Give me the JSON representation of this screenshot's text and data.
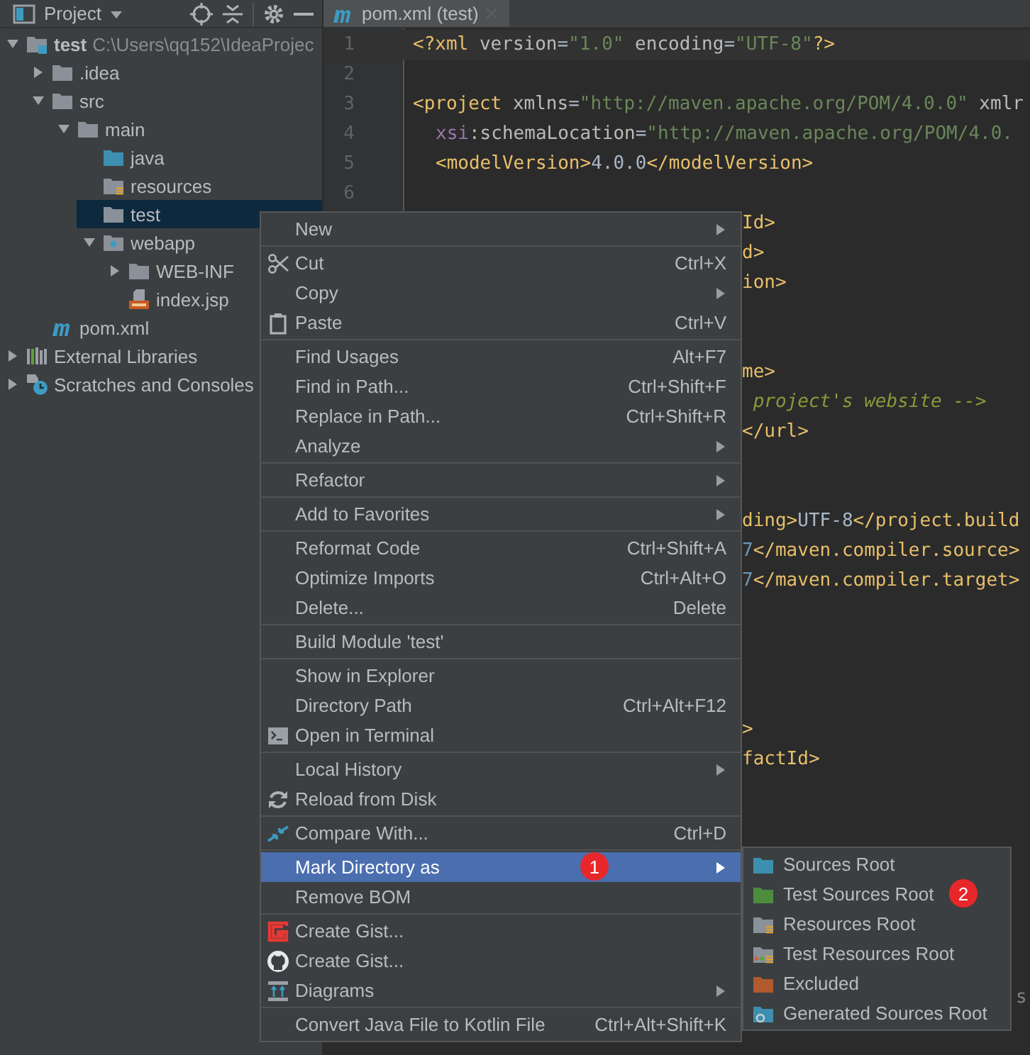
{
  "project_panel": {
    "title": "Project",
    "tree": [
      {
        "label": "test",
        "path": "C:\\Users\\qq152\\IdeaProjec",
        "kind": "module",
        "expanded": true,
        "selected": false,
        "children": [
          {
            "label": ".idea",
            "kind": "folder",
            "expanded": false,
            "selected": false,
            "has_children": true
          },
          {
            "label": "src",
            "kind": "folder",
            "expanded": true,
            "selected": false,
            "children": [
              {
                "label": "main",
                "kind": "folder",
                "expanded": true,
                "selected": false,
                "children": [
                  {
                    "label": "java",
                    "kind": "source",
                    "selected": false
                  },
                  {
                    "label": "resources",
                    "kind": "resources",
                    "selected": false
                  },
                  {
                    "label": "test",
                    "kind": "folder",
                    "selected": true
                  },
                  {
                    "label": "webapp",
                    "kind": "web",
                    "expanded": true,
                    "selected": false,
                    "children": [
                      {
                        "label": "WEB-INF",
                        "kind": "folder",
                        "expanded": false,
                        "selected": false,
                        "has_children": true
                      },
                      {
                        "label": "index.jsp",
                        "kind": "jsp",
                        "selected": false
                      }
                    ]
                  }
                ]
              }
            ]
          },
          {
            "label": "pom.xml",
            "kind": "maven",
            "selected": false
          }
        ]
      },
      {
        "label": "External Libraries",
        "kind": "libraries",
        "expanded": false,
        "selected": false,
        "has_children": true
      },
      {
        "label": "Scratches and Consoles",
        "kind": "scratches",
        "expanded": false,
        "selected": false,
        "has_children": true
      }
    ]
  },
  "editor": {
    "tab": {
      "label": "pom.xml (test)",
      "selected": true
    },
    "lines": [
      {
        "kind": "plain",
        "number": "1",
        "current": true,
        "segments": [
          {
            "kind": "tag",
            "text": "<?xml "
          },
          {
            "kind": "attr",
            "text": "version"
          },
          {
            "kind": "text",
            "text": "="
          },
          {
            "kind": "value",
            "text": "\"1.0\""
          },
          {
            "kind": "attr",
            "text": " encoding"
          },
          {
            "kind": "text",
            "text": "="
          },
          {
            "kind": "value",
            "text": "\"UTF-8\""
          },
          {
            "kind": "tag",
            "text": "?>"
          }
        ]
      },
      {
        "kind": "plain",
        "number": "2",
        "current": false
      },
      {
        "kind": "plain",
        "number": "3",
        "current": false,
        "segments": [
          {
            "kind": "tag",
            "text": "<project"
          },
          {
            "kind": "attr",
            "text": " xmlns"
          },
          {
            "kind": "text",
            "text": "="
          },
          {
            "kind": "value",
            "text": "\"http://maven.apache.org/POM/4.0.0\""
          },
          {
            "kind": "attr",
            "text": " xmlr"
          }
        ]
      },
      {
        "kind": "nested",
        "number": "4",
        "current": false,
        "segments": [
          {
            "kind": "ns",
            "text": "xsi"
          },
          {
            "kind": "attr",
            "text": ":schemaLocation"
          },
          {
            "kind": "text",
            "text": "="
          },
          {
            "kind": "value",
            "text": "\"http://maven.apache.org/POM/4.0."
          }
        ]
      },
      {
        "kind": "nested",
        "number": "5",
        "current": false,
        "segments": [
          {
            "kind": "tag",
            "text": "<modelVersion>"
          },
          {
            "kind": "text",
            "text": "4.0.0"
          },
          {
            "kind": "tag",
            "text": "</modelVersion>"
          }
        ]
      },
      {
        "kind": "plain",
        "number": "6",
        "current": false
      },
      {
        "kind": "covered",
        "segments": [
          {
            "kind": "tag",
            "text": "Id>"
          }
        ]
      },
      {
        "kind": "covered",
        "segments": [
          {
            "kind": "tag",
            "text": "d>"
          }
        ]
      },
      {
        "kind": "covered",
        "segments": [
          {
            "kind": "tag",
            "text": "ion>"
          }
        ]
      },
      {
        "kind": "covered"
      },
      {
        "kind": "covered"
      },
      {
        "kind": "covered",
        "segments": [
          {
            "kind": "tag",
            "text": "me>"
          }
        ]
      },
      {
        "kind": "covered",
        "segments": [
          {
            "kind": "comment",
            "text": " project's website -->"
          }
        ]
      },
      {
        "kind": "covered",
        "segments": [
          {
            "kind": "tag",
            "text": "</url>"
          }
        ]
      },
      {
        "kind": "covered"
      },
      {
        "kind": "covered"
      },
      {
        "kind": "covered",
        "segments": [
          {
            "kind": "tag",
            "text": "ding>"
          },
          {
            "kind": "text",
            "text": "UTF-8"
          },
          {
            "kind": "tag",
            "text": "</project.build"
          }
        ]
      },
      {
        "kind": "covered",
        "segments": [
          {
            "kind": "number",
            "text": "7"
          },
          {
            "kind": "tag",
            "text": "</maven.compiler.source>"
          }
        ]
      },
      {
        "kind": "covered",
        "segments": [
          {
            "kind": "number",
            "text": "7"
          },
          {
            "kind": "tag",
            "text": "</maven.compiler.target>"
          }
        ]
      },
      {
        "kind": "covered"
      },
      {
        "kind": "covered"
      },
      {
        "kind": "covered"
      },
      {
        "kind": "covered"
      },
      {
        "kind": "covered",
        "segments": [
          {
            "kind": "tag",
            "text": ">"
          }
        ]
      },
      {
        "kind": "covered",
        "segments": [
          {
            "kind": "tag",
            "text": "factId>"
          }
        ]
      },
      {
        "kind": "covered"
      },
      {
        "kind": "covered"
      },
      {
        "kind": "covered"
      },
      {
        "kind": "covered"
      },
      {
        "kind": "covered"
      },
      {
        "kind": "covered"
      },
      {
        "kind": "covered"
      },
      {
        "kind": "overlapped",
        "segments": [
          {
            "kind": "gray",
            "text": "s"
          }
        ]
      }
    ]
  },
  "context_menu": {
    "items": [
      {
        "kind": "item",
        "label": "New",
        "submenu": true,
        "selected": false
      },
      {
        "kind": "separator"
      },
      {
        "kind": "scissors",
        "label": "Cut",
        "shortcut": "Ctrl+X",
        "selected": false
      },
      {
        "kind": "item",
        "label": "Copy",
        "submenu": true,
        "selected": false
      },
      {
        "kind": "clipboard",
        "label": "Paste",
        "shortcut": "Ctrl+V",
        "selected": false
      },
      {
        "kind": "separator"
      },
      {
        "kind": "item",
        "label": "Find Usages",
        "shortcut": "Alt+F7",
        "selected": false
      },
      {
        "kind": "item",
        "label": "Find in Path...",
        "shortcut": "Ctrl+Shift+F",
        "selected": false
      },
      {
        "kind": "item",
        "label": "Replace in Path...",
        "shortcut": "Ctrl+Shift+R",
        "selected": false
      },
      {
        "kind": "item",
        "label": "Analyze",
        "submenu": true,
        "selected": false
      },
      {
        "kind": "separator"
      },
      {
        "kind": "item",
        "label": "Refactor",
        "submenu": true,
        "selected": false
      },
      {
        "kind": "separator"
      },
      {
        "kind": "item",
        "label": "Add to Favorites",
        "submenu": true,
        "selected": false
      },
      {
        "kind": "separator"
      },
      {
        "kind": "item",
        "label": "Reformat Code",
        "shortcut": "Ctrl+Shift+A",
        "selected": false
      },
      {
        "kind": "item",
        "label": "Optimize Imports",
        "shortcut": "Ctrl+Alt+O",
        "selected": false
      },
      {
        "kind": "item",
        "label": "Delete...",
        "shortcut": "Delete",
        "selected": false
      },
      {
        "kind": "separator"
      },
      {
        "kind": "item",
        "label": "Build Module 'test'",
        "selected": false
      },
      {
        "kind": "separator"
      },
      {
        "kind": "item",
        "label": "Show in Explorer",
        "selected": false
      },
      {
        "kind": "item",
        "label": "Directory Path",
        "shortcut": "Ctrl+Alt+F12",
        "selected": false
      },
      {
        "kind": "terminal",
        "label": "Open in Terminal",
        "selected": false
      },
      {
        "kind": "separator"
      },
      {
        "kind": "item",
        "label": "Local History",
        "submenu": true,
        "selected": false
      },
      {
        "kind": "reload",
        "label": "Reload from Disk",
        "selected": false
      },
      {
        "kind": "separator"
      },
      {
        "kind": "compare",
        "label": "Compare With...",
        "shortcut": "Ctrl+D",
        "selected": false
      },
      {
        "kind": "separator"
      },
      {
        "kind": "item",
        "label": "Mark Directory as",
        "submenu": true,
        "selected": true,
        "badge": "1"
      },
      {
        "kind": "item",
        "label": "Remove BOM",
        "selected": false
      },
      {
        "kind": "separator"
      },
      {
        "kind": "gist",
        "label": "Create Gist...",
        "selected": false
      },
      {
        "kind": "github",
        "label": "Create Gist...",
        "selected": false
      },
      {
        "kind": "diagram",
        "label": "Diagrams",
        "submenu": true,
        "selected": false
      },
      {
        "kind": "separator"
      },
      {
        "kind": "item",
        "label": "Convert Java File to Kotlin File",
        "shortcut": "Ctrl+Alt+Shift+K",
        "selected": false
      }
    ]
  },
  "submenu": {
    "items": [
      {
        "label": "Sources Root",
        "kind": "source",
        "selected": false
      },
      {
        "label": "Test Sources Root",
        "kind": "test-source",
        "selected": false,
        "badge": "2"
      },
      {
        "label": "Resources Root",
        "kind": "resources",
        "selected": false
      },
      {
        "label": "Test Resources Root",
        "kind": "test-resources",
        "selected": false
      },
      {
        "label": "Excluded",
        "kind": "excluded",
        "selected": false
      },
      {
        "label": "Generated Sources Root",
        "kind": "generated",
        "selected": false
      }
    ]
  }
}
